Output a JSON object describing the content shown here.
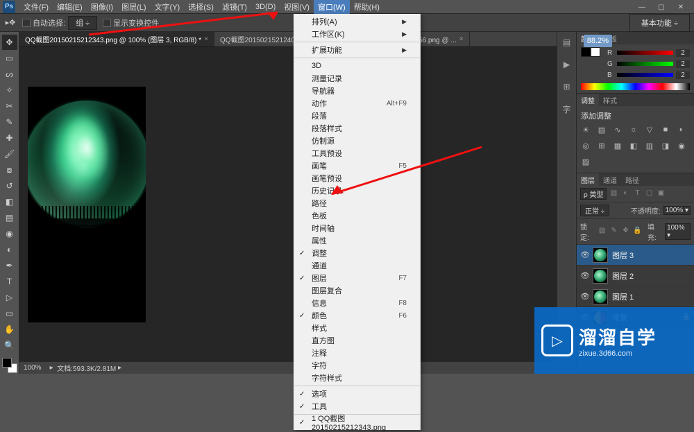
{
  "menubar": {
    "items": [
      "文件(F)",
      "编辑(E)",
      "图像(I)",
      "图层(L)",
      "文字(Y)",
      "选择(S)",
      "滤镜(T)",
      "3D(D)",
      "视图(V)",
      "窗口(W)",
      "帮助(H)"
    ],
    "active_index": 9
  },
  "optionsbar": {
    "auto_select_label": "自动选择:",
    "group_value": "组",
    "show_transform_label": "显示变换控件",
    "workspace_label": "基本功能"
  },
  "tabs": [
    {
      "label": "QQ截图20150215212343.png @ 100% (图层 3, RGB/8) *",
      "active": true
    },
    {
      "label": "QQ截图20150215212407.png @ ...",
      "active": false
    },
    {
      "label": "QQ截图20150215212456.png @ ...",
      "active": false
    }
  ],
  "dropdown": {
    "arrange": "排列(A)",
    "workspace": "工作区(K)",
    "extensions": "扩展功能",
    "threeD": "3D",
    "measurement": "测量记录",
    "navigator": "导航器",
    "actions": "动作",
    "actions_sc": "Alt+F9",
    "paragraph": "段落",
    "paragraph_styles": "段落样式",
    "clone_source": "仿制源",
    "toolpresets": "工具预设",
    "brush": "画笔",
    "brush_sc": "F5",
    "brush_presets": "画笔预设",
    "history": "历史记录",
    "paths": "路径",
    "swatches": "色板",
    "timeline": "时间轴",
    "properties": "属性",
    "adjustments": "调整",
    "channels": "通道",
    "layers": "图层",
    "layers_sc": "F7",
    "layer_comps": "图层复合",
    "info": "信息",
    "info_sc": "F8",
    "color": "颜色",
    "color_sc": "F6",
    "styles": "样式",
    "histogram": "直方图",
    "notes": "注释",
    "character": "字符",
    "char_styles": "字符样式",
    "options": "选项",
    "tools": "工具",
    "doc1": "1 QQ截图20150215212343.png"
  },
  "color_panel": {
    "tab_color": "颜色",
    "tab_swatches": "色板",
    "r_label": "R",
    "r_val": "2",
    "g_label": "G",
    "g_val": "2",
    "b_label": "B",
    "b_val": "2"
  },
  "adjust_panel": {
    "tab_adjust": "调整",
    "tab_styles": "样式",
    "title": "添加调整"
  },
  "layers_panel": {
    "tab_layers": "图层",
    "tab_channels": "通道",
    "tab_paths": "路径",
    "filter_kind": "ρ 类型",
    "blend": "正常",
    "opacity_label": "不透明度:",
    "opacity_val": "100%",
    "lock_label": "锁定:",
    "fill_label": "填充:",
    "fill_val": "100%",
    "layers": [
      {
        "name": "图层 3",
        "sel": true,
        "thumb": "aurora"
      },
      {
        "name": "图层 2",
        "sel": false,
        "thumb": "aurora"
      },
      {
        "name": "图层 1",
        "sel": false,
        "thumb": "aurora"
      },
      {
        "name": "背景",
        "sel": false,
        "thumb": "yy",
        "locked": true
      }
    ]
  },
  "status": {
    "zoom": "100%",
    "doc_size": "文档:593.3K/2.81M"
  },
  "zoom_tip": "88.2%",
  "watermark": {
    "title": "溜溜自学",
    "url": "zixue.3d66.com"
  }
}
